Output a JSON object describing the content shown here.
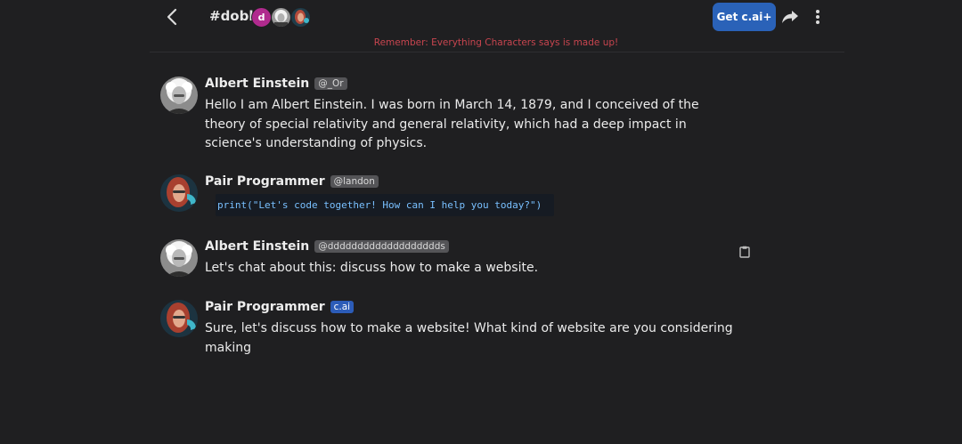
{
  "header": {
    "room_title": "#dobl",
    "member_initial": "d",
    "get_button_label": "Get c.ai+",
    "icons": [
      "back-arrow-icon",
      "share-icon",
      "more-vertical-icon"
    ]
  },
  "disclaimer": "Remember: Everything Characters says is made up!",
  "messages": [
    {
      "author": "Albert Einstein",
      "handle": "@_Or",
      "text": "Hello I am Albert Einstein. I was born in March 14, 1879, and I conceived of the theory of special relativity and general relativity, which had a deep impact in science's understanding of physics."
    },
    {
      "author": "Pair Programmer",
      "handle": "@landon",
      "code": "print(\"Let's code together! How can I help you today?\")"
    },
    {
      "author": "Albert Einstein",
      "handle": "@ddddddddddddddddddds",
      "text": "Let's chat about this: discuss how to make a website."
    },
    {
      "author": "Pair Programmer",
      "handle": "c.ai",
      "text": "Sure, let's discuss how to make a website! What kind of website are you considering making"
    }
  ],
  "colors": {
    "background": "#1f1f21",
    "accent": "#2a62b8",
    "disclaimer": "#c8454f"
  }
}
